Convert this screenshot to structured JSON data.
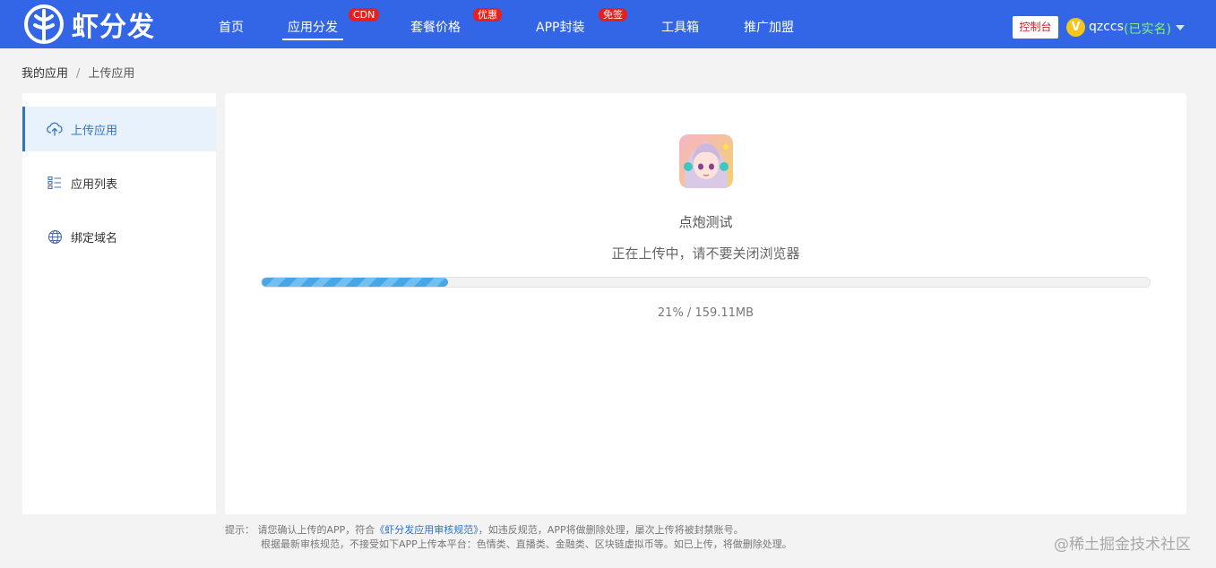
{
  "header": {
    "logo_text": "虾分发",
    "nav": [
      {
        "label": "首页"
      },
      {
        "label": "应用分发",
        "badge": "CDN"
      },
      {
        "label": "套餐价格",
        "badge": "优惠"
      },
      {
        "label": "APP封装",
        "badge": "免签"
      },
      {
        "label": "工具箱"
      },
      {
        "label": "推广加盟"
      }
    ],
    "console_label": "控制台",
    "vip_icon": "V",
    "user_name": "qzccs",
    "user_status": "(已实名)"
  },
  "breadcrumb": {
    "root": "我的应用",
    "separator": "/",
    "current": "上传应用"
  },
  "sidebar": {
    "items": [
      {
        "label": "上传应用",
        "icon": "cloud-upload-icon"
      },
      {
        "label": "应用列表",
        "icon": "list-icon"
      },
      {
        "label": "绑定域名",
        "icon": "globe-icon"
      }
    ]
  },
  "upload": {
    "app_name": "点炮测试",
    "status": "正在上传中，请不要关闭浏览器",
    "progress_percent": 21,
    "progress_text": "21% / 159.11MB"
  },
  "tips": {
    "prefix": "提示：",
    "line1_before": "请您确认上传的APP，符合",
    "line1_link": "《虾分发应用审核规范》",
    "line1_after": "，如违反规范，APP将做删除处理，屡次上传将被封禁账号。",
    "line2": "根据最新审核规范，不接受如下APP上传本平台：色情类、直播类、金融类、区块链虚拟币等。如已上传，将做删除处理。"
  },
  "watermark": "@稀土掘金技术社区",
  "colors": {
    "header_bg": "#3366e6",
    "accent": "#2f74c5",
    "badge": "#e5201d",
    "progress": "#46a6e6"
  }
}
